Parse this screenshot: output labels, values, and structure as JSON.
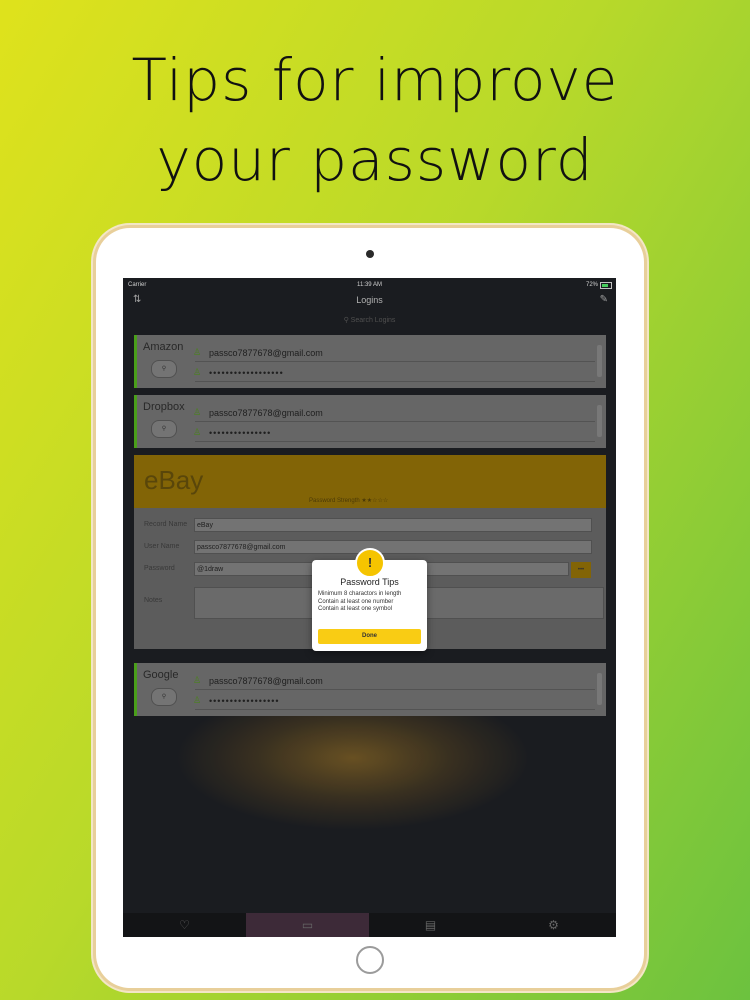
{
  "headline": [
    "Tips for improve",
    "your password"
  ],
  "status": {
    "carrier": "Carrier",
    "time": "11:39 AM",
    "battery": "72%"
  },
  "nav": {
    "title": "Logins",
    "left_icon": "sort-icon",
    "right_icon": "compose-icon"
  },
  "search": {
    "placeholder": "Search Logins"
  },
  "cards": [
    {
      "name": "Amazon",
      "email": "passco7877678@gmail.com",
      "password": "••••••••••••••••••"
    },
    {
      "name": "Dropbox",
      "email": "passco7877678@gmail.com",
      "password": "•••••••••••••••"
    },
    {
      "name": "Google",
      "email": "passco7877678@gmail.com",
      "password": "•••••••••••••••••"
    }
  ],
  "ebay": {
    "title": "eBay",
    "strength": "Password Strength ★★☆☆☆",
    "fields": [
      {
        "label": "Record Name",
        "value": "eBay"
      },
      {
        "label": "User Name",
        "value": "passco7877678@gmail.com"
      },
      {
        "label": "Password",
        "value": "@1draw"
      }
    ],
    "gen_button": "•••",
    "notes_label": "Notes"
  },
  "dialog": {
    "title": "Password Tips",
    "tips": [
      "Minimum 8 charactors in length",
      "Contain at least one number",
      "Contain at least one symbol"
    ],
    "button": "Done"
  },
  "tabs": [
    {
      "icon": "heart-icon",
      "glyph": "♡"
    },
    {
      "icon": "window-icon",
      "glyph": "▭"
    },
    {
      "icon": "document-icon",
      "glyph": "▤"
    },
    {
      "icon": "gear-icon",
      "glyph": "⚙"
    }
  ],
  "colors": {
    "accent": "#f9cc14",
    "brand_green": "#4fa81c"
  }
}
